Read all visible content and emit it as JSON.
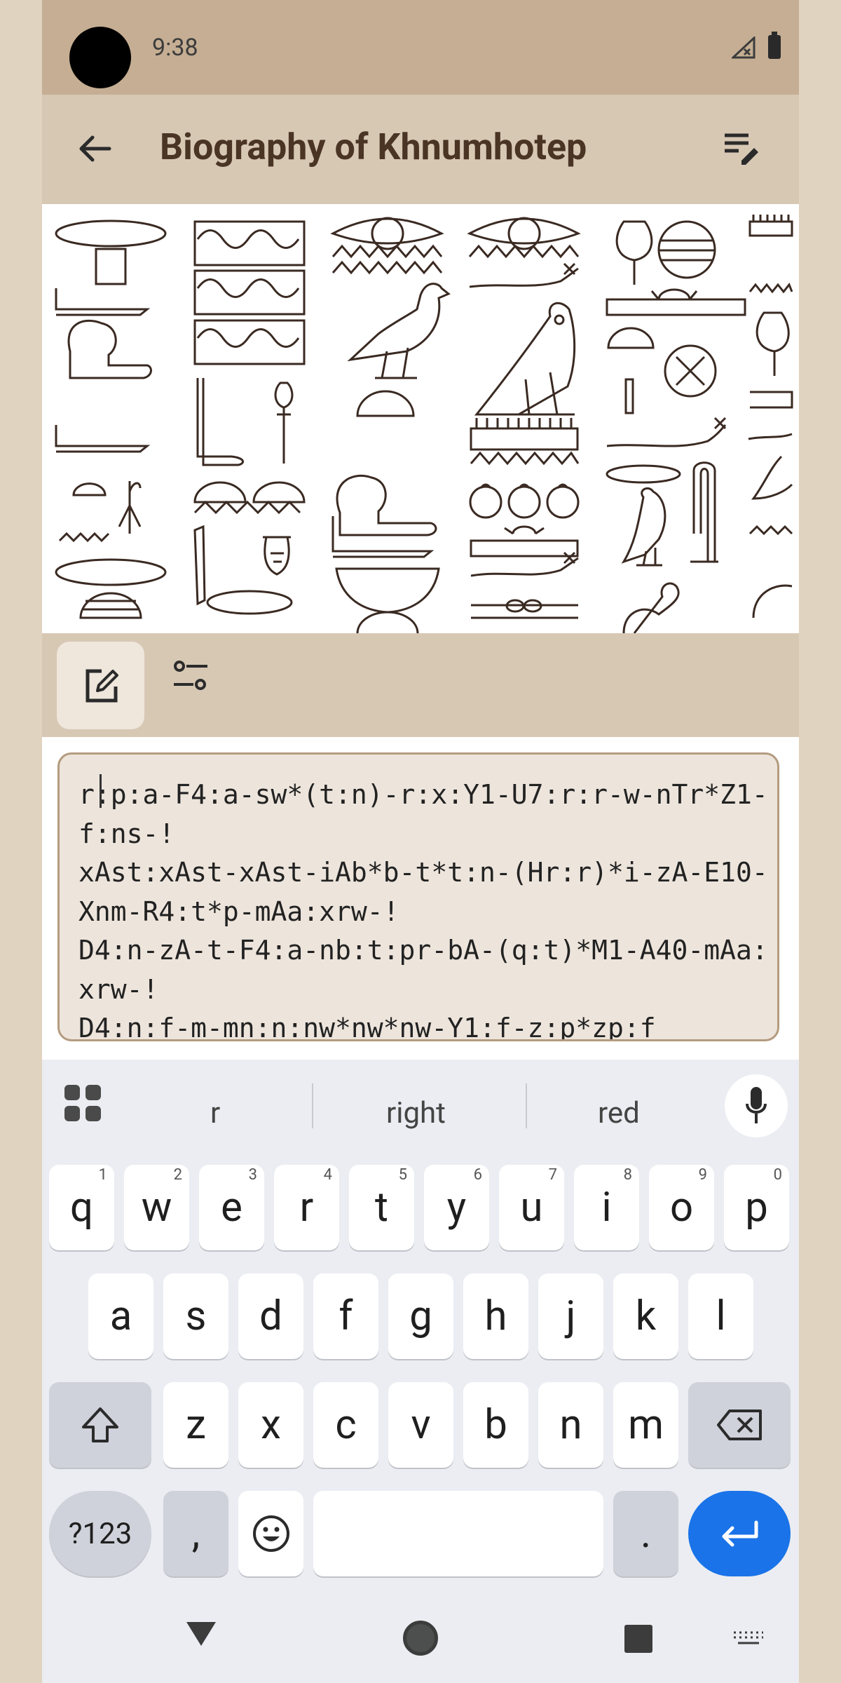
{
  "status": {
    "time": "9:38"
  },
  "app": {
    "title": "Biography of Khnumhotep"
  },
  "editor": {
    "text": "r:p:a-F4:a-sw*(t:n)-r:x:Y1-U7:r:r-w-nTr*Z1-f:ns-!\nxAst:xAst-xAst-iAb*b-t*t:n-(Hr:r)*i-zA-E10-Xnm-R4:t*p-mAa:xrw-!\nD4:n-zA-t-F4:a-nb:t:pr-bA-(q:t)*M1-A40-mAa:xrw-!\nD4:n:f-m-mn:n:nw*nw*nw-Y1:f-z:p*zp:f"
  },
  "keyboard": {
    "suggestions": [
      "r",
      "right",
      "red"
    ],
    "row1": [
      {
        "label": "q",
        "hint": "1"
      },
      {
        "label": "w",
        "hint": "2"
      },
      {
        "label": "e",
        "hint": "3"
      },
      {
        "label": "r",
        "hint": "4"
      },
      {
        "label": "t",
        "hint": "5"
      },
      {
        "label": "y",
        "hint": "6"
      },
      {
        "label": "u",
        "hint": "7"
      },
      {
        "label": "i",
        "hint": "8"
      },
      {
        "label": "o",
        "hint": "9"
      },
      {
        "label": "p",
        "hint": "0"
      }
    ],
    "row2": [
      "a",
      "s",
      "d",
      "f",
      "g",
      "h",
      "j",
      "k",
      "l"
    ],
    "row3": [
      "z",
      "x",
      "c",
      "v",
      "b",
      "n",
      "m"
    ],
    "symbols_label": "?123",
    "comma_label": ",",
    "period_label": "."
  }
}
